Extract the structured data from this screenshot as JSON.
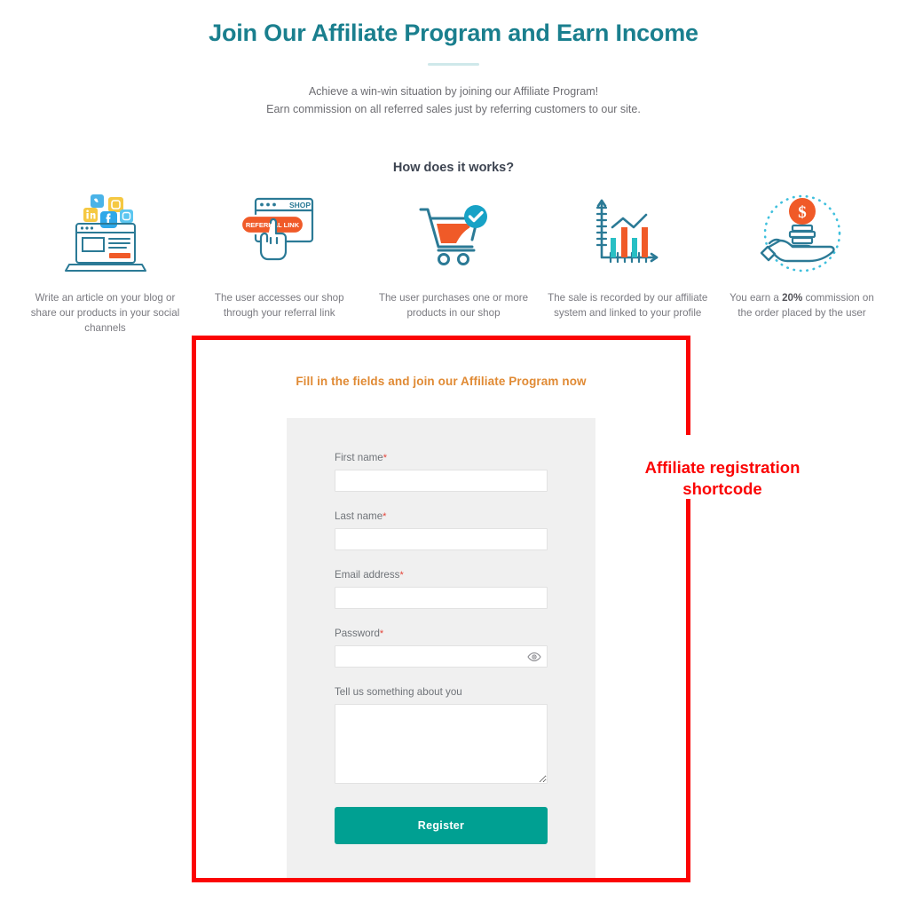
{
  "hero": {
    "title": "Join Our Affiliate Program and Earn Income",
    "subtitle_line1": "Achieve a win-win situation by joining our Affiliate Program!",
    "subtitle_line2": "Earn commission on all referred sales just by referring customers to our site.",
    "title_color": "#1a7f8e",
    "divider_color": "#cfe8ea"
  },
  "how_it_works": {
    "title": "How does it works?",
    "steps": [
      {
        "icon": "blog-social-share-icon",
        "caption_line1": "Write an article on your blog or",
        "caption_line2": "share our products in your social",
        "caption_line3": "channels"
      },
      {
        "icon": "referral-link-click-icon",
        "caption_line1": "The user accesses our shop",
        "caption_line2": "through your referral link",
        "browser_label": "SHOP",
        "button_label": "REFERRAL LINK"
      },
      {
        "icon": "shopping-cart-check-icon",
        "caption_line1": "The user purchases one or more",
        "caption_line2": "products in our shop"
      },
      {
        "icon": "sales-chart-icon",
        "caption_line1": "The sale is recorded by our affiliate",
        "caption_line2": "system and linked to your profile"
      },
      {
        "icon": "hand-coins-commission-icon",
        "caption_prefix": "You earn a ",
        "caption_bold": "20%",
        "caption_suffix": " commission on",
        "caption_line2": "the order placed by the user"
      }
    ]
  },
  "annotation": {
    "label_line1": "Affiliate registration",
    "label_line2": "shortcode",
    "color": "#fb0404"
  },
  "form": {
    "heading": "Fill in the fields and join our Affiliate Program now",
    "heading_color": "#e08a34",
    "fields": [
      {
        "label": "First name",
        "required": true,
        "value": "",
        "placeholder": ""
      },
      {
        "label": "Last name",
        "required": true,
        "value": "",
        "placeholder": ""
      },
      {
        "label": "Email address",
        "required": true,
        "value": "",
        "placeholder": ""
      },
      {
        "label": "Password",
        "required": true,
        "value": "",
        "placeholder": ""
      },
      {
        "label": "Tell us something about you",
        "required": false,
        "value": "",
        "placeholder": ""
      }
    ],
    "required_marker": "*",
    "submit_label": "Register",
    "submit_color": "#00a092",
    "panel_color": "#f0f0f0"
  }
}
